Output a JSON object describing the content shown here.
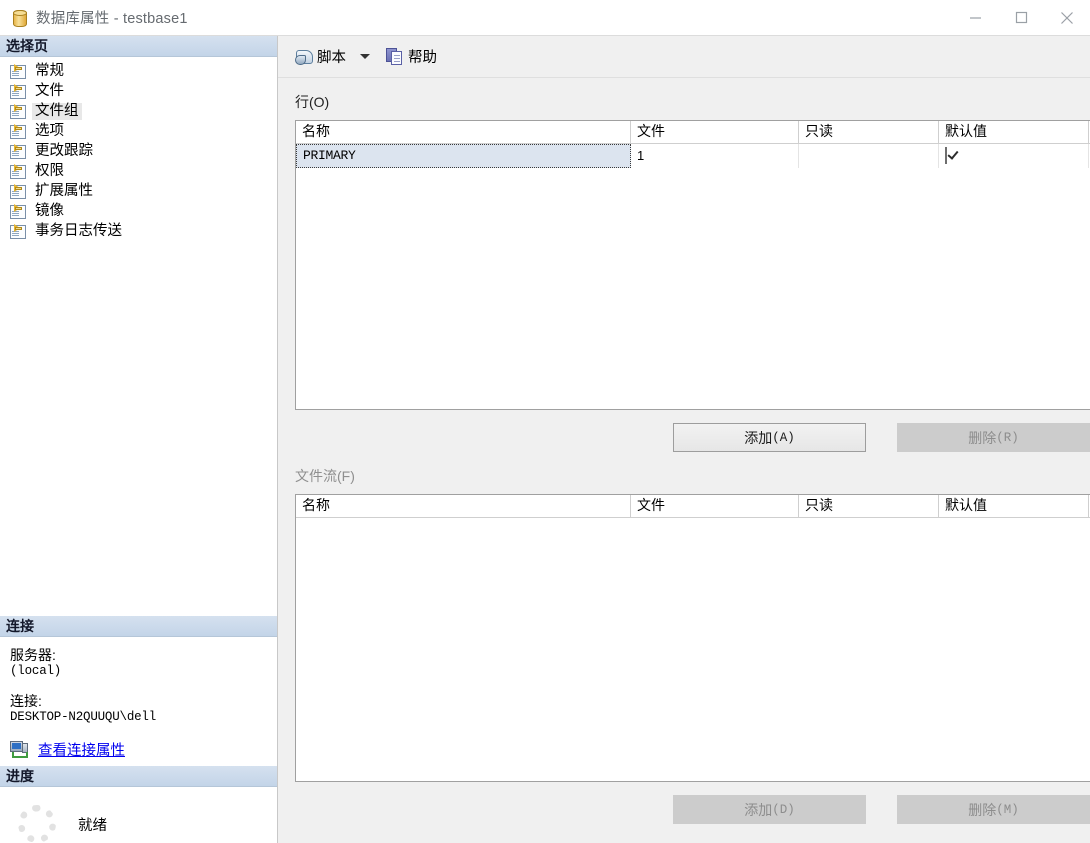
{
  "window": {
    "title": "数据库属性 - testbase1",
    "icon": "database-icon",
    "controls": {
      "minimize": "minimize-icon",
      "maximize": "maximize-icon",
      "close": "close-icon"
    }
  },
  "sidebar": {
    "select_page_header": "选择页",
    "items": [
      {
        "label": "常规",
        "selected": false
      },
      {
        "label": "文件",
        "selected": false
      },
      {
        "label": "文件组",
        "selected": true
      },
      {
        "label": "选项",
        "selected": false
      },
      {
        "label": "更改跟踪",
        "selected": false
      },
      {
        "label": "权限",
        "selected": false
      },
      {
        "label": "扩展属性",
        "selected": false
      },
      {
        "label": "镜像",
        "selected": false
      },
      {
        "label": "事务日志传送",
        "selected": false
      }
    ],
    "connection": {
      "header": "连接",
      "server_label": "服务器:",
      "server_value": "(local)",
      "connection_label": "连接:",
      "connection_value": "DESKTOP-N2QUUQU\\dell",
      "link_text": "查看连接属性",
      "link_icon": "server-connection-icon"
    },
    "progress": {
      "header": "进度",
      "status": "就绪",
      "spinner_icon": "progress-spinner-icon"
    }
  },
  "toolbar": {
    "script_label": "脚本",
    "script_icon": "script-icon",
    "dropdown_icon": "chevron-down-icon",
    "help_label": "帮助",
    "help_icon": "help-icon"
  },
  "rows_section": {
    "label": "行(O)",
    "columns": [
      "名称",
      "文件",
      "只读",
      "默认值"
    ],
    "rows": [
      {
        "name": "PRIMARY",
        "files": "1",
        "readonly": "",
        "is_default": true,
        "selected": true
      }
    ],
    "add_button": {
      "text": "添加",
      "mnemonic": "(A)",
      "enabled": true
    },
    "remove_button": {
      "text": "删除",
      "mnemonic": "(R)",
      "enabled": false
    }
  },
  "filestream_section": {
    "label": "文件流(F)",
    "enabled": false,
    "columns": [
      "名称",
      "文件",
      "只读",
      "默认值"
    ],
    "rows": [],
    "add_button": {
      "text": "添加",
      "mnemonic": "(D)",
      "enabled": false
    },
    "remove_button": {
      "text": "删除",
      "mnemonic": "(M)",
      "enabled": false
    }
  },
  "colors": {
    "panel_header": "#c9d9ea",
    "selection": "#dce4ef",
    "link": "#0000ee",
    "disabled_button": "#cccccc"
  }
}
